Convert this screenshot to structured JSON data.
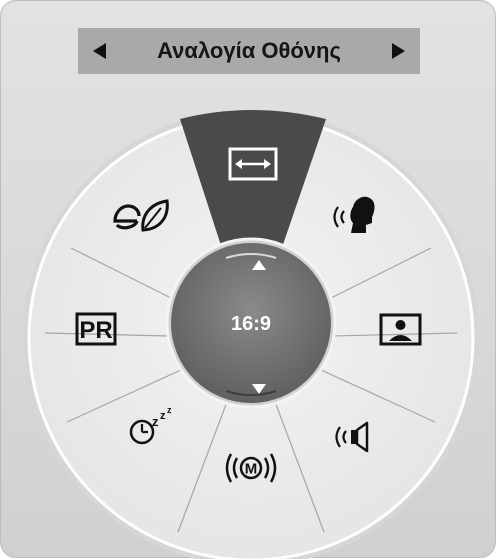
{
  "header": {
    "title": "Αναλογία Οθόνης",
    "prev_icon": "left-triangle-icon",
    "next_icon": "right-triangle-icon"
  },
  "center": {
    "value": "16:9",
    "up_icon": "up-triangle-icon",
    "down_icon": "down-triangle-icon"
  },
  "menu_items": [
    {
      "icon": "aspect-ratio-icon",
      "selected": true
    },
    {
      "icon": "voice-speech-icon"
    },
    {
      "icon": "picture-mode-icon"
    },
    {
      "icon": "sound-mode-icon"
    },
    {
      "icon": "mts-audio-icon",
      "label": "M"
    },
    {
      "icon": "sleep-timer-icon",
      "label": "z"
    },
    {
      "icon": "program-edit-icon",
      "label": "PR"
    },
    {
      "icon": "energy-saving-icon"
    }
  ],
  "colors": {
    "selected_sector": "#4a4a4a",
    "center_ring": "#6a6a6a",
    "title_bar": "#a9a9a9",
    "panel": "#dcdcdc"
  }
}
